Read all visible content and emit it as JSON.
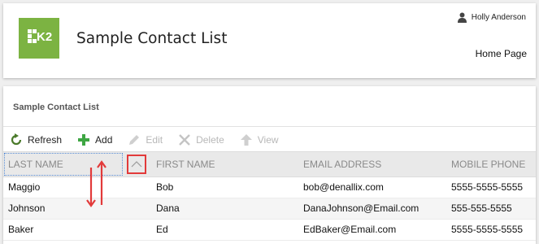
{
  "header": {
    "app_title": "Sample Contact List",
    "user_name": "Holly Anderson",
    "home_link": "Home Page",
    "logo_text": "K2",
    "brand_color": "#7cb342"
  },
  "panel": {
    "title": "Sample Contact List"
  },
  "toolbar": {
    "refresh": "Refresh",
    "add": "Add",
    "edit": "Edit",
    "delete": "Delete",
    "view": "View"
  },
  "table": {
    "columns": [
      "LAST NAME",
      "FIRST NAME",
      "EMAIL ADDRESS",
      "MOBILE PHONE"
    ],
    "rows": [
      [
        "Maggio",
        "Bob",
        "bob@denallix.com",
        "5555-5555-5555"
      ],
      [
        "Johnson",
        "Dana",
        "DanaJohnson@Email.com",
        "555-555-5555"
      ],
      [
        "Baker",
        "Ed",
        "EdBaker@Email.com",
        "5555-5555-5555"
      ]
    ]
  },
  "colors": {
    "annotation": "#e23a3a",
    "focus": "#5a8ed6",
    "add_icon": "#3ea643",
    "refresh_icon": "#4a7a2a"
  },
  "icons": {
    "user": "user-icon",
    "refresh": "refresh-icon",
    "add": "plus-icon",
    "edit": "pencil-icon",
    "delete": "x-icon",
    "view": "arrow-up-icon",
    "sort": "chevron-up-icon"
  }
}
